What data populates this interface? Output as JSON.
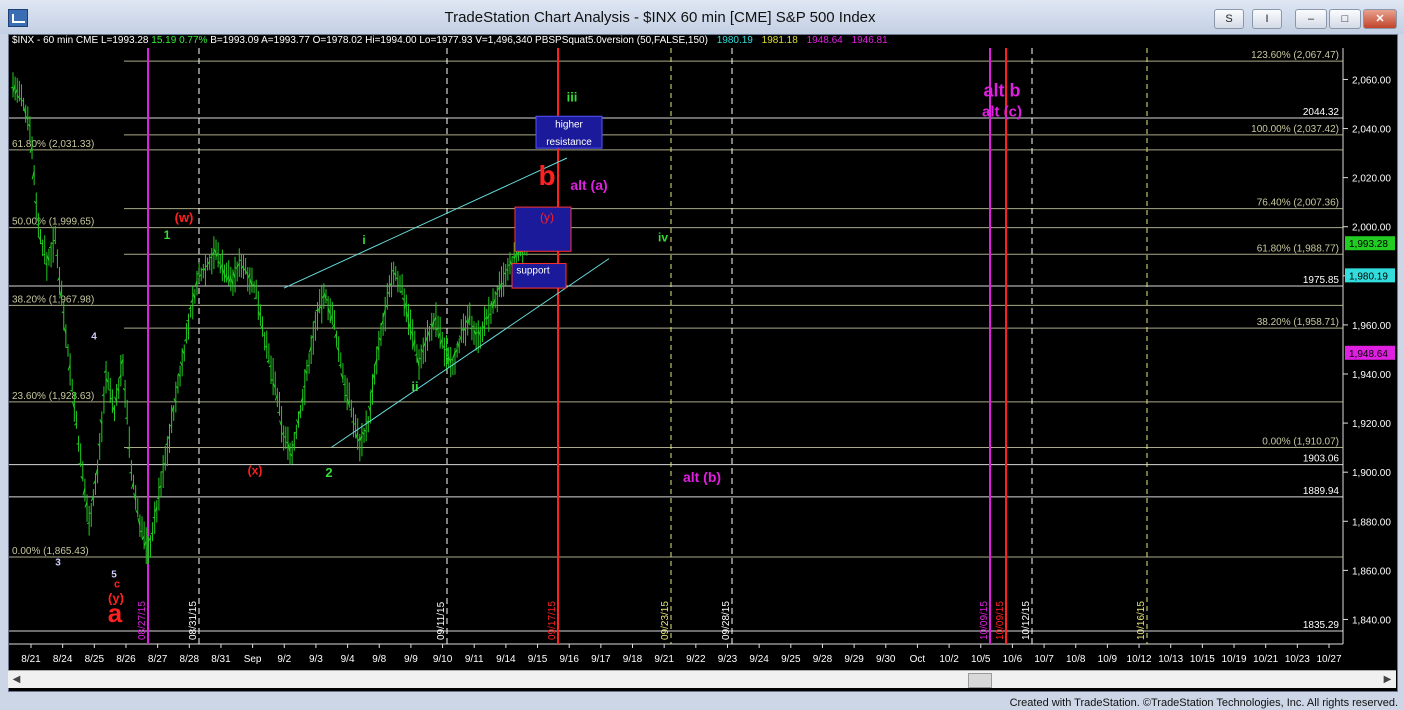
{
  "window": {
    "title": "TradeStation Chart Analysis - $INX 60 min [CME] S&P 500 Index",
    "buttons": [
      "S",
      "I",
      "–",
      "□",
      "✕"
    ]
  },
  "status": {
    "symbol": "$INX - 60 min",
    "exchange": "CME",
    "last": "L=1993.28",
    "change": "15.19",
    "pct": "0.77%",
    "bid": "B=1993.09",
    "ask": "A=1993.77",
    "open": "O=1978.02",
    "high": "Hi=1994.00",
    "low": "Lo=1977.93",
    "volume": "V=1,496,340",
    "indicator": "PBSPSquat5.0version (50,FALSE,150)",
    "ind_values": [
      "1980.19",
      "1981.18",
      "1948.64",
      "1946.81"
    ]
  },
  "footer": "Created with TradeStation. ©TradeStation Technologies, Inc. All rights reserved.",
  "colors": {
    "bars": "#22cc22",
    "magenta": "#e020e0",
    "red": "#ff2020",
    "cyan": "#66dddd",
    "green_label": "#33dd33",
    "blue_box": "#1a1a9a",
    "fib": "#c8c8a0",
    "white": "#ffffff"
  },
  "chart_data": {
    "type": "ohlc",
    "title": "$INX 60 min [CME] S&P 500 Index",
    "ylim": [
      1830,
      2072
    ],
    "yticks": [
      "1,840.00",
      "1,860.00",
      "1,880.00",
      "1,900.00",
      "1,920.00",
      "1,940.00",
      "1,960.00",
      "1,980.00",
      "2,000.00",
      "2,020.00",
      "2,040.00",
      "2,060.00"
    ],
    "xticks": [
      "8/21",
      "8/24",
      "8/25",
      "8/26",
      "8/27",
      "8/28",
      "8/31",
      "Sep",
      "9/2",
      "9/3",
      "9/4",
      "9/8",
      "9/9",
      "9/10",
      "9/11",
      "9/14",
      "9/15",
      "9/16",
      "9/17",
      "9/18",
      "9/21",
      "9/22",
      "9/23",
      "9/24",
      "9/25",
      "9/28",
      "9/29",
      "9/30",
      "Oct",
      "10/2",
      "10/5",
      "10/6",
      "10/7",
      "10/8",
      "10/9",
      "10/12",
      "10/13",
      "10/15",
      "10/19",
      "10/21",
      "10/23",
      "10/27"
    ],
    "price_path": [
      [
        0,
        2058
      ],
      [
        2,
        2052
      ],
      [
        4,
        2042
      ],
      [
        6,
        2000
      ],
      [
        8,
        1985
      ],
      [
        10,
        1995
      ],
      [
        12,
        1965
      ],
      [
        14,
        1935
      ],
      [
        16,
        1905
      ],
      [
        18,
        1880
      ],
      [
        20,
        1900
      ],
      [
        22,
        1940
      ],
      [
        24,
        1925
      ],
      [
        26,
        1945
      ],
      [
        28,
        1900
      ],
      [
        30,
        1880
      ],
      [
        32,
        1867
      ],
      [
        34,
        1885
      ],
      [
        36,
        1905
      ],
      [
        38,
        1925
      ],
      [
        40,
        1945
      ],
      [
        42,
        1965
      ],
      [
        44,
        1980
      ],
      [
        46,
        1985
      ],
      [
        48,
        1990
      ],
      [
        50,
        1982
      ],
      [
        52,
        1978
      ],
      [
        54,
        1986
      ],
      [
        56,
        1980
      ],
      [
        58,
        1970
      ],
      [
        60,
        1950
      ],
      [
        62,
        1935
      ],
      [
        64,
        1915
      ],
      [
        66,
        1908
      ],
      [
        68,
        1925
      ],
      [
        70,
        1945
      ],
      [
        72,
        1965
      ],
      [
        74,
        1972
      ],
      [
        76,
        1960
      ],
      [
        78,
        1940
      ],
      [
        80,
        1925
      ],
      [
        82,
        1912
      ],
      [
        84,
        1920
      ],
      [
        86,
        1945
      ],
      [
        88,
        1965
      ],
      [
        90,
        1982
      ],
      [
        92,
        1975
      ],
      [
        94,
        1960
      ],
      [
        96,
        1945
      ],
      [
        98,
        1955
      ],
      [
        100,
        1962
      ],
      [
        102,
        1950
      ],
      [
        104,
        1945
      ],
      [
        106,
        1955
      ],
      [
        108,
        1962
      ],
      [
        110,
        1955
      ],
      [
        112,
        1962
      ],
      [
        114,
        1970
      ],
      [
        116,
        1978
      ],
      [
        118,
        1985
      ],
      [
        120,
        1990
      ],
      [
        122,
        1993
      ]
    ],
    "right_value_tags": [
      {
        "label": "1,993.28",
        "value": 1993.28,
        "color": "#22cc22"
      },
      {
        "label": "1,980.19",
        "value": 1980.19,
        "color": "#33dddd"
      },
      {
        "label": "1,948.64",
        "value": 1948.64,
        "color": "#e020e0"
      }
    ],
    "hlines": [
      {
        "value": 2067.47,
        "label": "123.60% (2,067.47)"
      },
      {
        "value": 2044.32,
        "label": "2044.32"
      },
      {
        "value": 2037.42,
        "label": "100.00% (2,037.42)"
      },
      {
        "value": 2031.33,
        "label": "61.80% (2,031.33)"
      },
      {
        "value": 2007.36,
        "label": "76.40% (2,007.36)"
      },
      {
        "value": 1999.65,
        "label": "50.00% (1,999.65)"
      },
      {
        "value": 1988.77,
        "label": "61.80% (1,988.77)"
      },
      {
        "value": 1975.85,
        "label": "1975.85"
      },
      {
        "value": 1967.98,
        "label": "38.20% (1,967.98)"
      },
      {
        "value": 1958.71,
        "label": "38.20% (1,958.71)"
      },
      {
        "value": 1928.63,
        "label": "23.60% (1,928.63)"
      },
      {
        "value": 1910.07,
        "label": "0.00% (1,910.07)"
      },
      {
        "value": 1903.06,
        "label": "1903.06"
      },
      {
        "value": 1889.94,
        "label": "1889.94"
      },
      {
        "value": 1865.43,
        "label": "0.00% (1,865.43)"
      },
      {
        "value": 1835.29,
        "label": "1835.29"
      }
    ],
    "vlines": [
      {
        "date": "08/27/15",
        "kind": "magenta"
      },
      {
        "date": "08/31/15",
        "kind": "white_dash"
      },
      {
        "date": "09/11/15",
        "kind": "white_dash"
      },
      {
        "date": "09/17/15",
        "kind": "red"
      },
      {
        "date": "09/23/15",
        "kind": "yellow_dash"
      },
      {
        "date": "09/28/15",
        "kind": "white_dash"
      },
      {
        "date": "10/09/15",
        "kind": "magenta"
      },
      {
        "date": "10/09/15",
        "kind": "red"
      },
      {
        "date": "10/12/15",
        "kind": "white_dash"
      },
      {
        "date": "10/16/15",
        "kind": "yellow_dash"
      }
    ],
    "zones": [
      {
        "label": "higher",
        "label2": "resistance"
      },
      {
        "label": "(y)"
      },
      {
        "label": "support"
      }
    ],
    "wave_labels": [
      {
        "text": "(w)",
        "color": "red"
      },
      {
        "text": "1",
        "color": "green"
      },
      {
        "text": "4",
        "color": "white"
      },
      {
        "text": "3",
        "color": "white"
      },
      {
        "text": "5",
        "color": "white"
      },
      {
        "text": "c",
        "color": "red"
      },
      {
        "text": "(y)",
        "color": "red"
      },
      {
        "text": "a",
        "color": "red"
      },
      {
        "text": "(x)",
        "color": "red"
      },
      {
        "text": "2",
        "color": "green"
      },
      {
        "text": "i",
        "color": "green"
      },
      {
        "text": "ii",
        "color": "green"
      },
      {
        "text": "iii",
        "color": "green"
      },
      {
        "text": "iv",
        "color": "green"
      },
      {
        "text": "b",
        "color": "red"
      },
      {
        "text": "alt (a)",
        "color": "magenta"
      },
      {
        "text": "alt (b)",
        "color": "magenta"
      },
      {
        "text": "alt b",
        "color": "magenta"
      },
      {
        "text": "alt (c)",
        "color": "magenta"
      }
    ]
  }
}
